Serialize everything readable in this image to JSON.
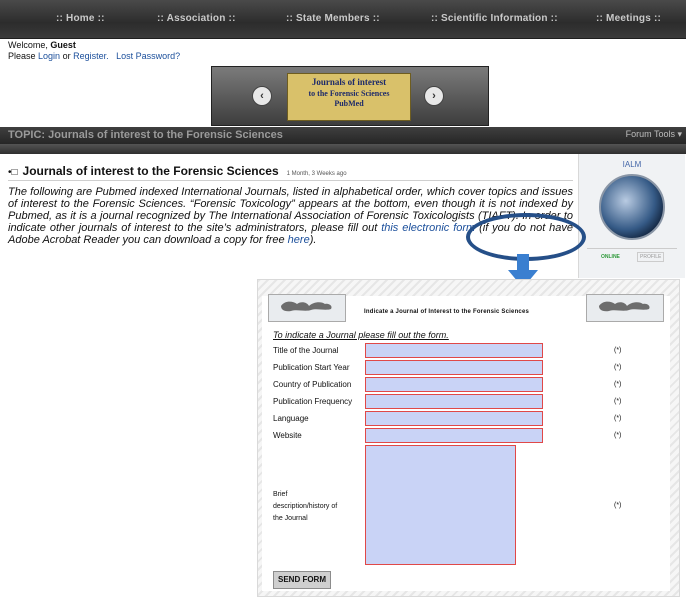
{
  "nav": [
    "Home",
    "Association",
    "State Members",
    "Scientific Information",
    "Meetings"
  ],
  "welcome": {
    "prefix": "Welcome, ",
    "user": "Guest",
    "please": "Please ",
    "login": "Login",
    "or": " or ",
    "register": "Register.",
    "lost_password": "Lost Password?"
  },
  "banner": {
    "line1": "Journals of interest",
    "line2": "to the Forensic Sciences",
    "line3": "PubMed"
  },
  "topic_bar": {
    "title": "TOPIC: Journals of interest to the Forensic Sciences",
    "tools": "Forum Tools"
  },
  "post": {
    "title": "Journals of interest to the Forensic Sciences",
    "age": "1 Month, 3 Weeks ago",
    "text_main": "The following are Pubmed indexed International Journals, listed in alphabetical order, which cover topics and issues of interest to the Forensic Sciences. “Forensic Toxicology” appears at the bottom, even though it is not indexed by Pubmed, as it is a journal recognized by The International Association of Forensic Toxicologists (TIAFT). In order to indicate other journals of interest to the site’s administrators, please fill out ",
    "link_form": "this electronic form",
    "text_mid": " (if you do not have Adobe Acrobat Reader you can download a copy for free ",
    "link_here": "here",
    "text_end": ")."
  },
  "sidebar": {
    "title": "IALM",
    "online": "ONLINE",
    "profile": "PROFILE"
  },
  "form": {
    "title_prefix": "Indicate a Journal of Interest to the Forensic Sciences",
    "intro": "To indicate a Journal please fill out the form.",
    "fields": [
      {
        "label": "Title of the Journal",
        "req": "(*)"
      },
      {
        "label": "Publication Start Year",
        "req": "(*)"
      },
      {
        "label": "Country of Publication",
        "req": "(*)"
      },
      {
        "label": "Publication Frequency",
        "req": "(*)"
      },
      {
        "label": "Language",
        "req": "(*)"
      },
      {
        "label": "Website",
        "req": "(*)"
      }
    ],
    "desc_line1": "Brief",
    "desc_line2": "description/history of",
    "desc_line3": "the Journal",
    "desc_req": "(*)",
    "send": "SEND FORM"
  },
  "colors": {
    "nav_bg": "#2c2c2c",
    "link": "#1b4f9b",
    "field_fill": "#c9d3f6",
    "field_border": "#e04848",
    "highlight": "#254f88"
  }
}
